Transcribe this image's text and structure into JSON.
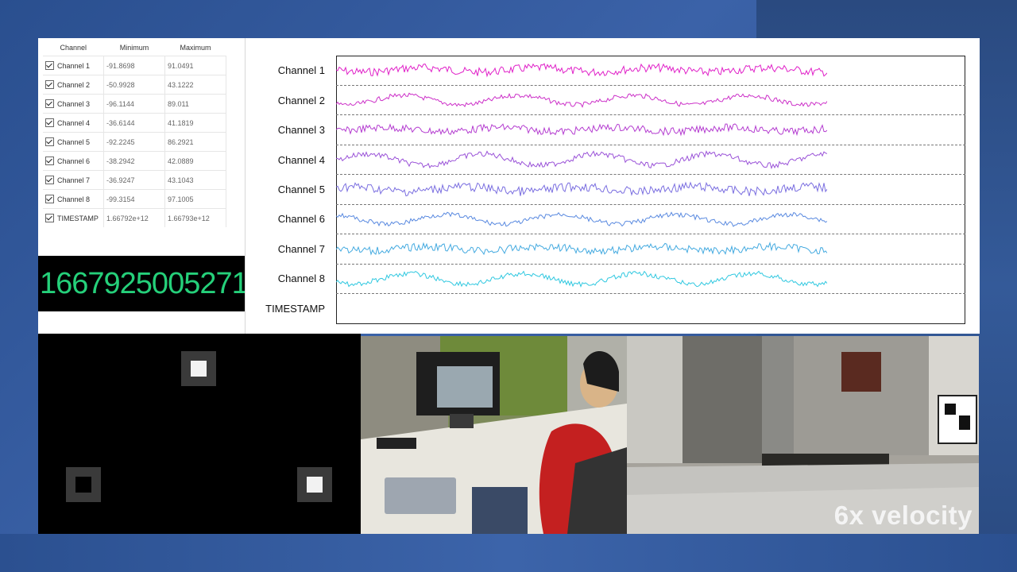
{
  "table": {
    "headers": [
      "Channel",
      "Minimum",
      "Maximum"
    ],
    "rows": [
      {
        "name": "Channel 1",
        "min": "-91.8698",
        "max": "91.0491"
      },
      {
        "name": "Channel 2",
        "min": "-50.9928",
        "max": "43.1222"
      },
      {
        "name": "Channel 3",
        "min": "-96.1144",
        "max": "89.011"
      },
      {
        "name": "Channel 4",
        "min": "-36.6144",
        "max": "41.1819"
      },
      {
        "name": "Channel 5",
        "min": "-92.2245",
        "max": "86.2921"
      },
      {
        "name": "Channel 6",
        "min": "-38.2942",
        "max": "42.0889"
      },
      {
        "name": "Channel 7",
        "min": "-36.9247",
        "max": "43.1043"
      },
      {
        "name": "Channel 8",
        "min": "-99.3154",
        "max": "97.1005"
      },
      {
        "name": "TIMESTAMP",
        "min": "1.66792e+12",
        "max": "1.66793e+12"
      }
    ]
  },
  "timestamp_display": "1667925005271",
  "graph": {
    "labels": [
      "Channel 1",
      "Channel 2",
      "Channel 3",
      "Channel 4",
      "Channel 5",
      "Channel 6",
      "Channel 7",
      "Channel 8",
      "TIMESTAMP"
    ],
    "colors": [
      "#e020c8",
      "#cc30c8",
      "#b43cd0",
      "#9a52d8",
      "#7a6ee0",
      "#5a8ae0",
      "#44aae0",
      "#30c8e0"
    ]
  },
  "overlay": {
    "velocity_text": "6x velocity"
  }
}
